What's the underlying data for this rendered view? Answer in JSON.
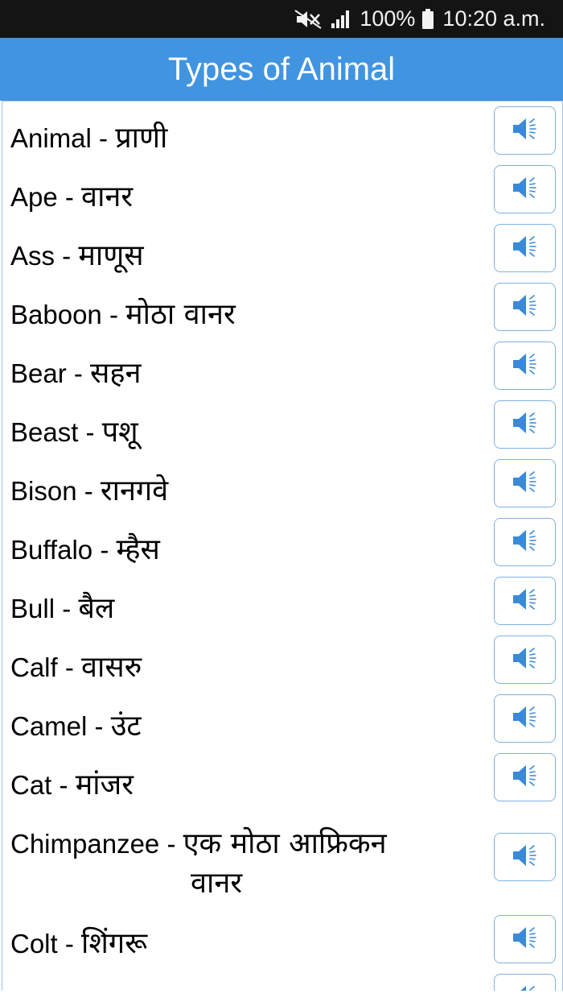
{
  "status_bar": {
    "battery": "100%",
    "time": "10:20 a.m."
  },
  "app_bar": {
    "title": "Types of Animal"
  },
  "items": [
    {
      "en": "Animal",
      "sep": " - ",
      "mr": "प्राणी"
    },
    {
      "en": "Ape",
      "sep": " - ",
      "mr": "वानर"
    },
    {
      "en": "Ass",
      "sep": " - ",
      "mr": "माणूस"
    },
    {
      "en": "Baboon",
      "sep": " - ",
      "mr": "मोठा वानर"
    },
    {
      "en": "Bear",
      "sep": " - ",
      "mr": "सहन"
    },
    {
      "en": "Beast",
      "sep": " - ",
      "mr": "पशू"
    },
    {
      "en": "Bison",
      "sep": " - ",
      "mr": "रानगवे"
    },
    {
      "en": "Buffalo",
      "sep": " - ",
      "mr": "म्हैस"
    },
    {
      "en": "Bull",
      "sep": " - ",
      "mr": "बैल"
    },
    {
      "en": "Calf",
      "sep": " - ",
      "mr": "वासरु"
    },
    {
      "en": "Camel",
      "sep": " - ",
      "mr": "उंट"
    },
    {
      "en": "Cat",
      "sep": " - ",
      "mr": "मांजर"
    },
    {
      "en": "Chimpanzee",
      "sep": " - ",
      "mr": "एक मोठा आफ्रिकन",
      "mr2": "वानर"
    },
    {
      "en": "Colt",
      "sep": " - ",
      "mr": "शिंगरू"
    }
  ],
  "icons": {
    "speaker": "speaker-icon"
  },
  "colors": {
    "app_bar": "#4194e0",
    "status_bar": "#141414",
    "button_border": "#7fb2e3"
  }
}
